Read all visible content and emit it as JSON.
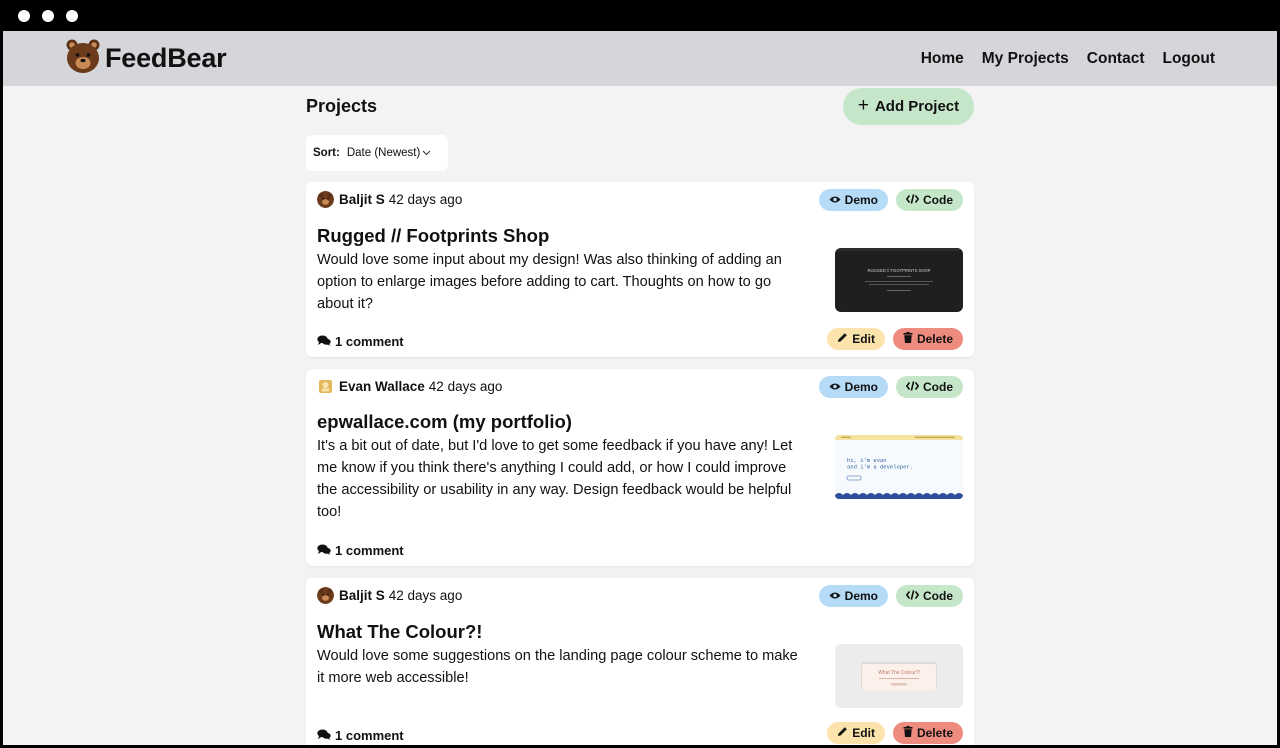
{
  "brand": {
    "name": "FeedBear"
  },
  "nav": {
    "items": [
      "Home",
      "My Projects",
      "Contact",
      "Logout"
    ]
  },
  "page": {
    "title": "Projects",
    "add_button": "Add Project"
  },
  "sort": {
    "label": "Sort:",
    "value": "Date (Newest)"
  },
  "labels": {
    "demo": "Demo",
    "code": "Code",
    "edit": "Edit",
    "delete": "Delete"
  },
  "projects": [
    {
      "author": "Baljit S",
      "time": "42 days ago",
      "title": "Rugged // Footprints Shop",
      "description": "Would love some input about my design! Was also thinking of adding an option to enlarge images before adding to cart. Thoughts on how to go about it?",
      "comments": "1 comment",
      "thumbnail": {
        "heading": "RUGGED // FOOTPRINTS SHOP"
      }
    },
    {
      "author": "Evan Wallace",
      "time": "42 days ago",
      "title": "epwallace.com (my portfolio)",
      "description": "It's a bit out of date, but I'd love to get some feedback if you have any! Let me know if you think there's anything I could add, or how I could improve the accessibility or usability in any way. Design feedback would be helpful too!",
      "comments": "1 comment",
      "thumbnail": {
        "line1": "hi, i'm evan",
        "line2": "and i'm a developer."
      }
    },
    {
      "author": "Baljit S",
      "time": "42 days ago",
      "title": "What The Colour?!",
      "description": "Would love some suggestions on the landing page colour scheme to make it more web accessible!",
      "comments": "1 comment",
      "thumbnail": {
        "heading": "What The Colour?!"
      }
    }
  ],
  "colors": {
    "navbar": "#d4d6da",
    "page_bg": "#f3f3f3",
    "demo": "#b6dbf7",
    "code": "#c6e6ca",
    "edit": "#fbe3ab",
    "delete": "#ee8b7f"
  }
}
